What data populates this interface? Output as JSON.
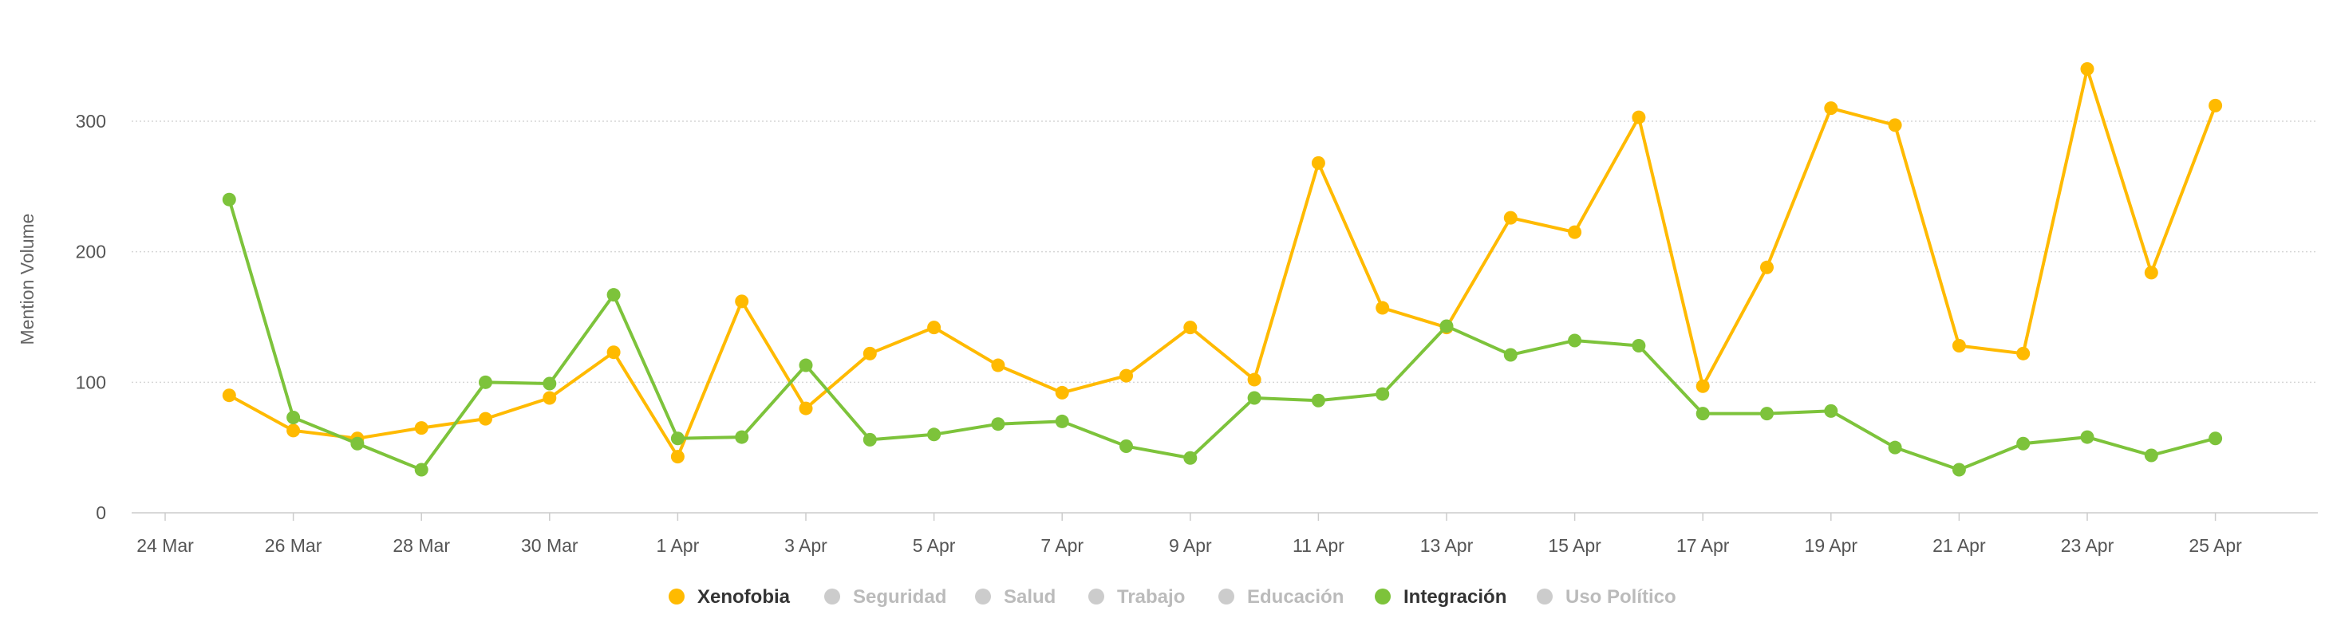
{
  "chart_data": {
    "type": "line",
    "title": "",
    "xlabel": "",
    "ylabel": "Mention Volume",
    "ylim": [
      0,
      350
    ],
    "yticks": [
      "0",
      "100",
      "200",
      "300"
    ],
    "ytick_values": [
      0,
      100,
      200,
      300
    ],
    "x": [
      "24 Mar",
      "25 Mar",
      "26 Mar",
      "27 Mar",
      "28 Mar",
      "29 Mar",
      "30 Mar",
      "31 Mar",
      "1 Apr",
      "2 Apr",
      "3 Apr",
      "4 Apr",
      "5 Apr",
      "6 Apr",
      "7 Apr",
      "8 Apr",
      "9 Apr",
      "10 Apr",
      "11 Apr",
      "12 Apr",
      "13 Apr",
      "14 Apr",
      "15 Apr",
      "16 Apr",
      "17 Apr",
      "18 Apr",
      "19 Apr",
      "20 Apr",
      "21 Apr",
      "22 Apr",
      "23 Apr",
      "24 Apr",
      "25 Apr",
      "26 Apr"
    ],
    "xticks": [
      "24 Mar",
      "26 Mar",
      "28 Mar",
      "30 Mar",
      "1 Apr",
      "3 Apr",
      "5 Apr",
      "7 Apr",
      "9 Apr",
      "11 Apr",
      "13 Apr",
      "15 Apr",
      "17 Apr",
      "19 Apr",
      "21 Apr",
      "23 Apr",
      "25 Apr"
    ],
    "grid": true,
    "legend_position": "bottom",
    "series": [
      {
        "name": "Xenofobia",
        "color": "#FFBA00",
        "visible": true,
        "x_start": "25 Mar",
        "values": [
          90,
          63,
          57,
          65,
          72,
          88,
          123,
          43,
          162,
          80,
          122,
          142,
          113,
          92,
          105,
          142,
          102,
          268,
          157,
          142,
          226,
          215,
          303,
          97,
          188,
          310,
          297,
          128,
          122,
          340,
          184,
          312
        ]
      },
      {
        "name": "Integración",
        "color": "#7DC33B",
        "visible": true,
        "x_start": "25 Mar",
        "values": [
          240,
          73,
          53,
          33,
          100,
          99,
          167,
          57,
          58,
          113,
          56,
          60,
          68,
          70,
          51,
          42,
          88,
          86,
          91,
          143,
          121,
          132,
          128,
          76,
          76,
          78,
          50,
          33,
          53,
          58,
          44,
          57
        ]
      }
    ],
    "legend": [
      {
        "name": "Xenofobia",
        "active": true,
        "color": "#FFBA00"
      },
      {
        "name": "Seguridad",
        "active": false,
        "color": "#CCCCCC"
      },
      {
        "name": "Salud",
        "active": false,
        "color": "#CCCCCC"
      },
      {
        "name": "Trabajo",
        "active": false,
        "color": "#CCCCCC"
      },
      {
        "name": "Educación",
        "active": false,
        "color": "#CCCCCC"
      },
      {
        "name": "Integración",
        "active": true,
        "color": "#7DC33B"
      },
      {
        "name": "Uso Político",
        "active": false,
        "color": "#CCCCCC"
      }
    ],
    "colors": {
      "grid": "#D6D6D6",
      "axis": "#CCCCCC",
      "legend_active_text": "#333333",
      "legend_inactive_text": "#BBBBBB",
      "legend_inactive_dot": "#CCCCCC"
    }
  }
}
